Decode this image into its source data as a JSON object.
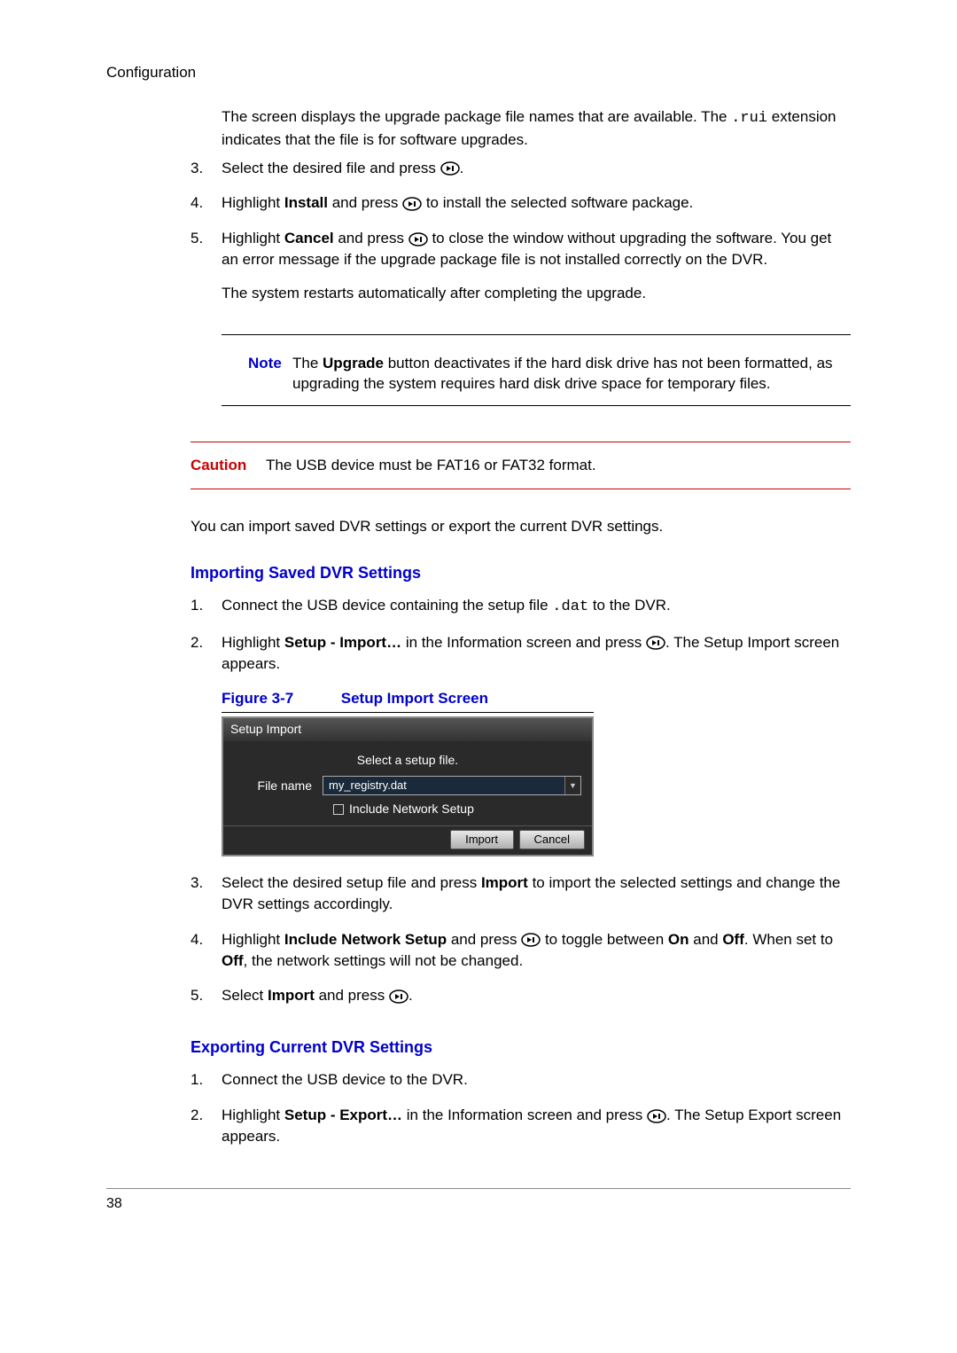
{
  "header": {
    "section": "Configuration"
  },
  "intro": {
    "p1a": "The screen displays the upgrade package file names that are available. The ",
    "p1code": ".rui",
    "p1b": " extension indicates that the file is for software upgrades."
  },
  "steps_a": {
    "s3_num": "3.",
    "s3": "Select the desired file and press ",
    "s3b": ".",
    "s4_num": "4.",
    "s4a": "Highlight ",
    "s4bold": "Install",
    "s4b": " and press ",
    "s4c": " to install the selected software package.",
    "s5_num": "5.",
    "s5a": "Highlight ",
    "s5bold": "Cancel",
    "s5b": " and press ",
    "s5c": " to close the window without upgrading the software. You get an error message if the upgrade package file is not installed correctly on the DVR.",
    "after": "The system restarts automatically after completing the upgrade."
  },
  "note": {
    "label": "Note",
    "a": "The ",
    "bold": "Upgrade",
    "b": " button deactivates if the hard disk drive has not been formatted, as upgrading the system requires hard disk drive space for temporary files."
  },
  "caution": {
    "label": "Caution",
    "text": "The USB device must be FAT16 or FAT32 format."
  },
  "ie_intro": "You can import saved DVR settings or export the current DVR settings.",
  "import": {
    "heading": "Importing Saved DVR Settings",
    "s1_num": "1.",
    "s1a": "Connect the USB device containing the setup file ",
    "s1code": ".dat",
    "s1b": " to the DVR.",
    "s2_num": "2.",
    "s2a": "Highlight ",
    "s2bold": "Setup - Import…",
    "s2b": " in the Information screen and press ",
    "s2c": ". The Setup Import screen appears.",
    "fig_num": "Figure 3-7",
    "fig_title": "Setup Import Screen",
    "s3_num": "3.",
    "s3a": "Select the desired setup file and press ",
    "s3bold": "Import",
    "s3b": " to import the selected settings and change the DVR settings accordingly.",
    "s4_num": "4.",
    "s4a": "Highlight ",
    "s4bold1": "Include Network Setup",
    "s4b": " and press ",
    "s4c": " to toggle between ",
    "s4bold2": "On",
    "s4d": " and ",
    "s4bold3": "Off",
    "s4e": ". When set to ",
    "s4bold4": "Off",
    "s4f": ", the network settings will not be changed.",
    "s5_num": "5.",
    "s5a": "Select ",
    "s5bold": "Import",
    "s5b": " and press ",
    "s5c": "."
  },
  "dialog": {
    "title": "Setup Import",
    "instruct": "Select a setup file.",
    "file_label": "File name",
    "file_value": "my_registry.dat",
    "include_label": "Include Network Setup",
    "import_btn": "Import",
    "cancel_btn": "Cancel"
  },
  "export": {
    "heading": "Exporting Current DVR Settings",
    "s1_num": "1.",
    "s1": "Connect the USB device to the DVR.",
    "s2_num": "2.",
    "s2a": "Highlight ",
    "s2bold": "Setup - Export…",
    "s2b": " in the Information screen and press ",
    "s2c": ". The Setup Export screen appears."
  },
  "footer": {
    "page": "38"
  }
}
